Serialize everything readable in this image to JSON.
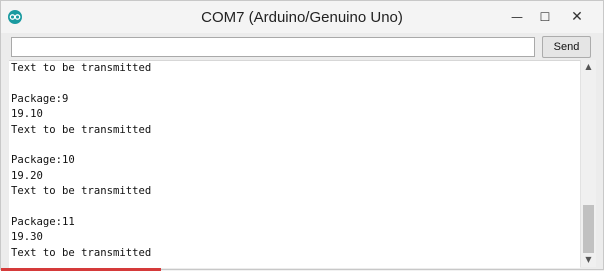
{
  "window": {
    "title": "COM7 (Arduino/Genuino Uno)",
    "controls": {
      "minimize": "—",
      "maximize": "☐",
      "close": "✕"
    }
  },
  "send_bar": {
    "input_value": "",
    "send_label": "Send"
  },
  "serial_output": {
    "lines": [
      "Text to be transmitted",
      "",
      "Package:9",
      "19.10",
      "Text to be transmitted",
      "",
      "Package:10",
      "19.20",
      "Text to be transmitted",
      "",
      "Package:11",
      "19.30",
      "Text to be transmitted"
    ]
  },
  "icons": {
    "app": "arduino-logo-icon",
    "scroll_up": "chevron-up-icon",
    "scroll_down": "chevron-down-icon"
  },
  "colors": {
    "app_icon": "#1a9aa0",
    "accent_line": "#d53a3a"
  }
}
